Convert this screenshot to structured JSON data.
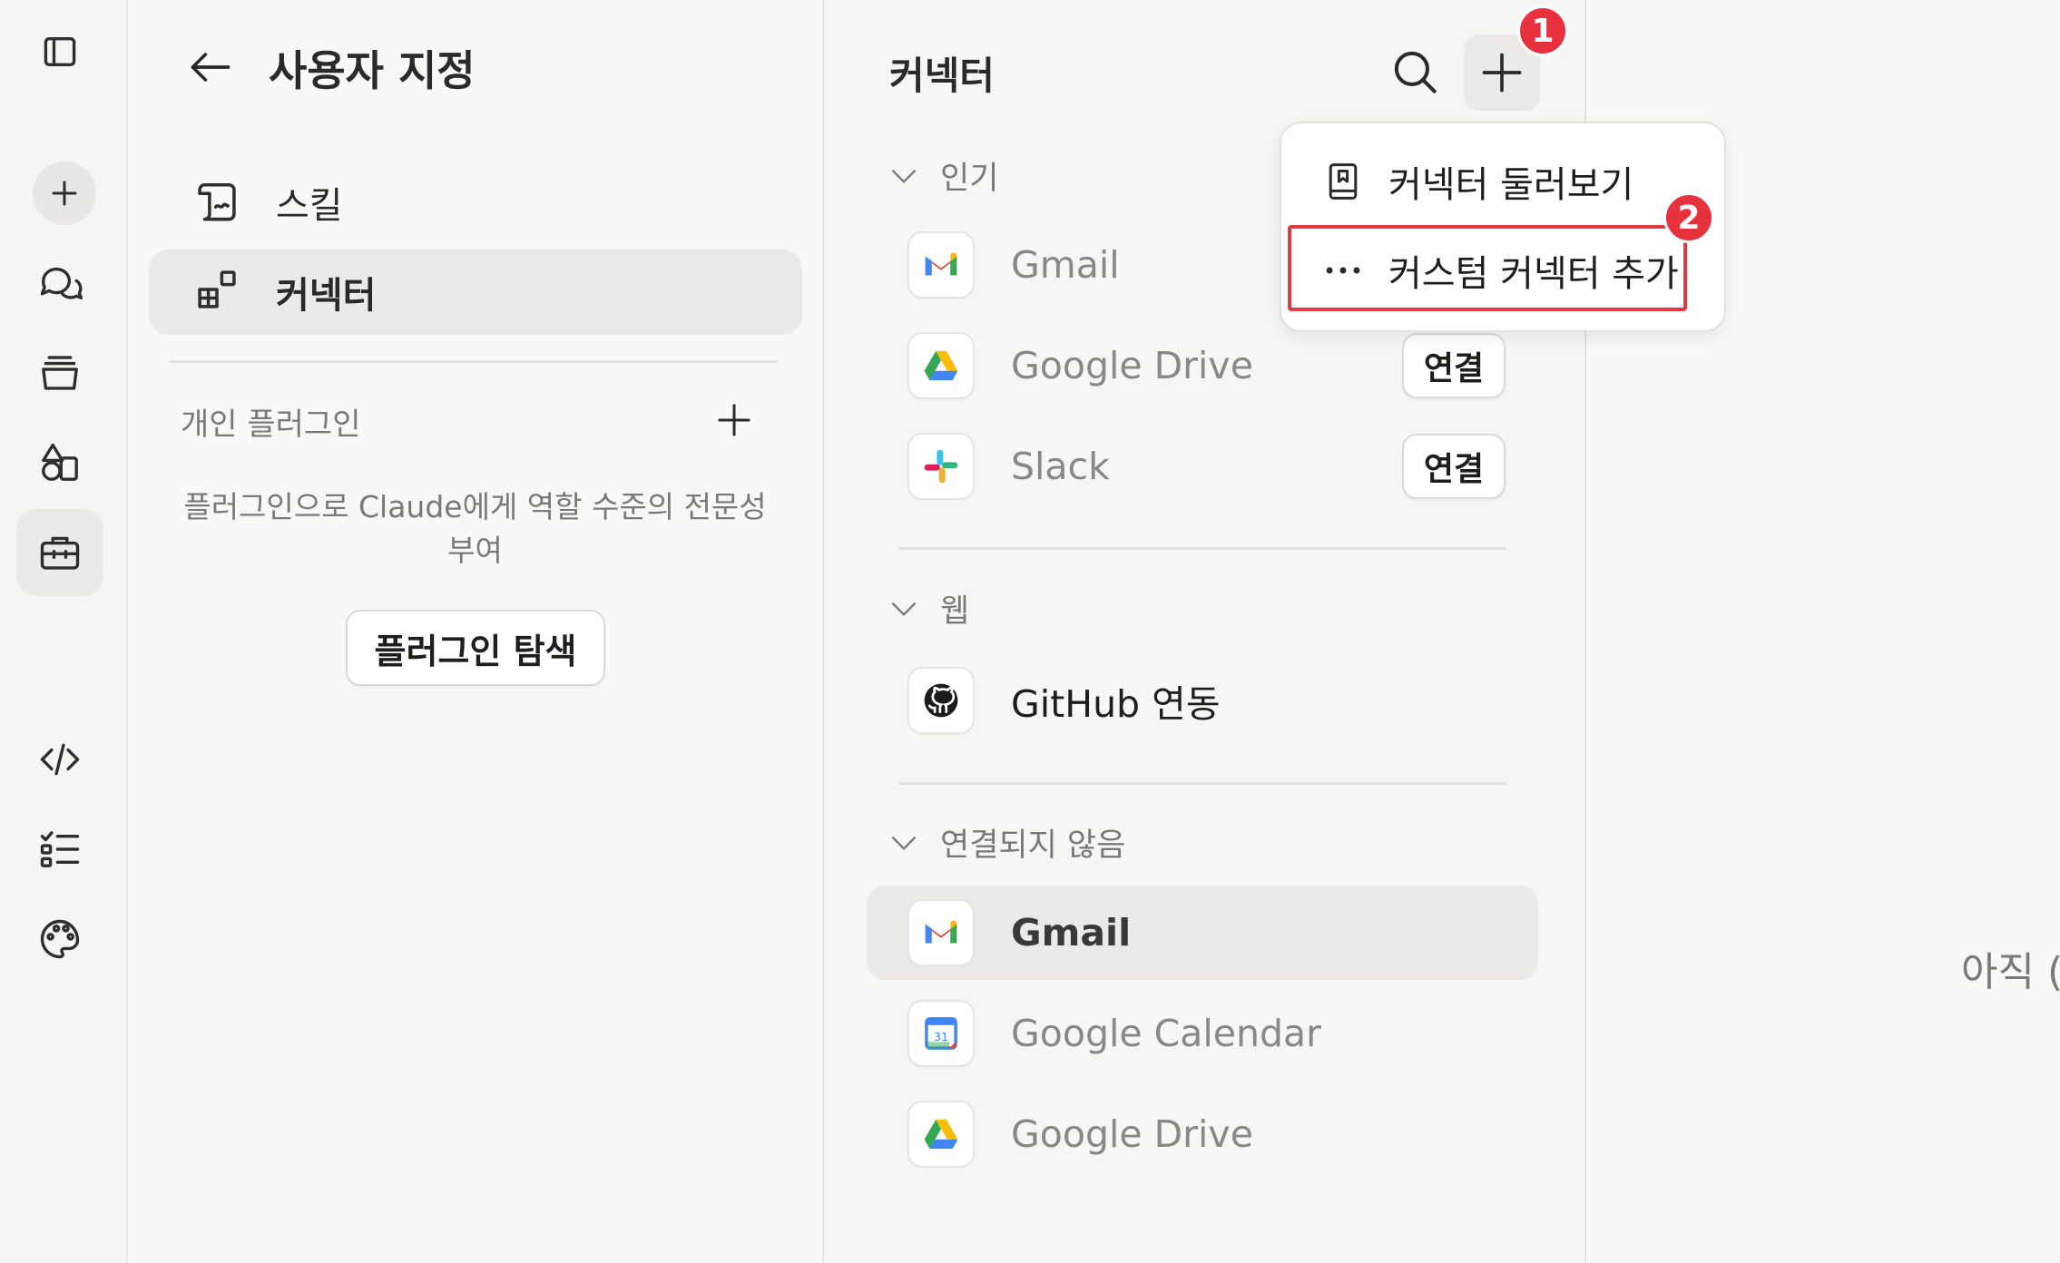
{
  "sidebar_rail": {
    "items": [
      {
        "name": "toggle-sidebar",
        "icon": "sidebar-panel-icon"
      },
      {
        "name": "new-chat",
        "icon": "plus-icon"
      },
      {
        "name": "chats",
        "icon": "chat-bubbles-icon"
      },
      {
        "name": "projects",
        "icon": "stack-icon"
      },
      {
        "name": "artifacts",
        "icon": "shapes-icon"
      },
      {
        "name": "customize",
        "icon": "toolbox-icon",
        "active": true
      },
      {
        "name": "code",
        "icon": "code-icon"
      },
      {
        "name": "tasks",
        "icon": "checklist-icon"
      },
      {
        "name": "appearance",
        "icon": "palette-icon"
      }
    ]
  },
  "customize_panel": {
    "title": "사용자 지정",
    "nav": [
      {
        "label": "스킬",
        "icon": "scroll-icon"
      },
      {
        "label": "커넥터",
        "icon": "grid-blocks-icon",
        "selected": true
      }
    ],
    "plugins_section": {
      "label": "개인 플러그인",
      "description": "플러그인으로 Claude에게 역할 수준의 전문성 부여",
      "browse_button": "플러그인 탐색"
    }
  },
  "connectors_panel": {
    "title": "커넥터",
    "sections": {
      "popular": {
        "label": "인기",
        "items": [
          {
            "name": "Gmail",
            "logo": "gmail-logo"
          },
          {
            "name": "Google Drive",
            "logo": "google-drive-logo",
            "action": "연결"
          },
          {
            "name": "Slack",
            "logo": "slack-logo",
            "action": "연결"
          }
        ]
      },
      "web": {
        "label": "웹",
        "items": [
          {
            "name": "GitHub 연동",
            "logo": "github-logo"
          }
        ]
      },
      "not_connected": {
        "label": "연결되지 않음",
        "items": [
          {
            "name": "Gmail",
            "logo": "gmail-logo",
            "selected": true
          },
          {
            "name": "Google Calendar",
            "logo": "google-calendar-logo"
          },
          {
            "name": "Google Drive",
            "logo": "google-drive-logo"
          }
        ]
      }
    }
  },
  "add_menu": {
    "items": [
      {
        "label": "커넥터 둘러보기",
        "icon": "book-icon"
      },
      {
        "label": "커스텀 커넥터 추가",
        "icon": "ellipsis-icon"
      }
    ]
  },
  "annotations": {
    "badge_1": "1",
    "badge_2": "2",
    "highlight_color": "#e23a44"
  },
  "detail_panel": {
    "partial_text": "아직 ("
  },
  "colors": {
    "accent_red": "#e7323e",
    "selected_bg": "#ebeae6",
    "rail_bg": "#f5f5f3"
  }
}
